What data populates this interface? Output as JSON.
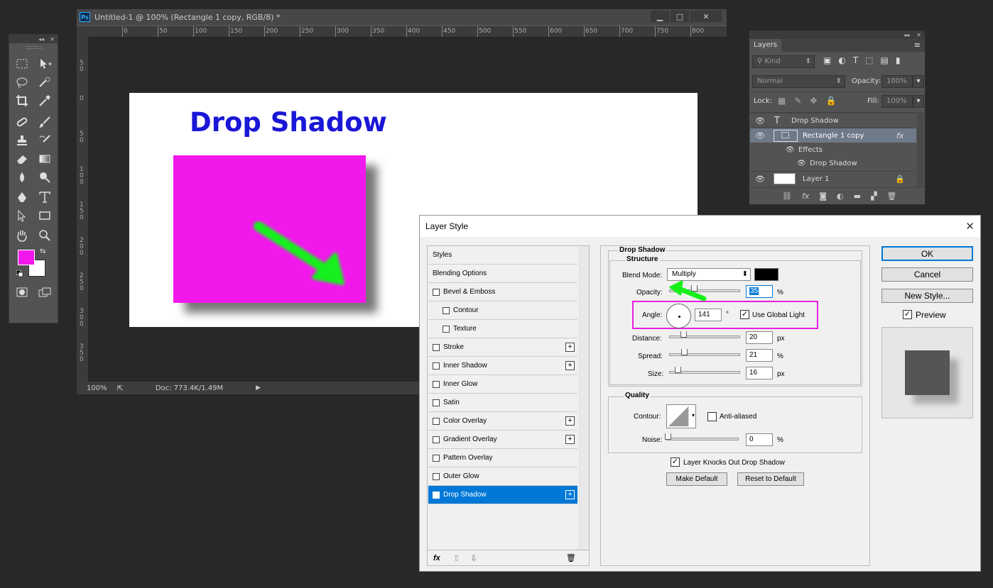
{
  "tools_panel": {
    "collapse": "◂◂",
    "close": "✕"
  },
  "document": {
    "app_badge": "Ps",
    "title": "Untitled-1 @ 100% (Rectangle 1 copy, RGB/8) *",
    "min": "▁",
    "max": "□",
    "close": "✕",
    "ruler_h": [
      "0",
      "50",
      "100",
      "150",
      "200",
      "250",
      "300",
      "350",
      "400",
      "450",
      "500",
      "550",
      "600",
      "650",
      "700",
      "750",
      "800"
    ],
    "ruler_v": [
      "5\n0",
      "0",
      "5\n0",
      "1\n0\n0",
      "1\n5\n0",
      "2\n0\n0",
      "2\n5\n0",
      "3\n0\n0",
      "3\n5\n0"
    ],
    "canvas_heading": "Drop Shadow",
    "zoom": "100%",
    "doc_info": "Doc: 773.4K/1.49M"
  },
  "layers_panel": {
    "tab": "Layers",
    "menu_icon": "≡",
    "collapse": "◂◂",
    "close": "✕",
    "kind": "Kind",
    "blend_mode": "Normal",
    "opacity_label": "Opacity:",
    "opacity_value": "100%",
    "lock_label": "Lock:",
    "fill_label": "Fill:",
    "fill_value": "100%",
    "layers": [
      {
        "name": "Drop Shadow",
        "type": "text"
      },
      {
        "name": "Rectangle 1 copy",
        "type": "shape",
        "fx": "fx"
      },
      {
        "name": "Effects",
        "type": "effects"
      },
      {
        "name": "Drop Shadow",
        "type": "effect"
      },
      {
        "name": "Layer 1",
        "type": "pixel"
      }
    ]
  },
  "dialog": {
    "title": "Layer Style",
    "close": "✕",
    "styles": [
      {
        "label": "Styles",
        "checkbox": false,
        "plus": false,
        "indent": false,
        "checked": false
      },
      {
        "label": "Blending Options",
        "checkbox": false,
        "plus": false,
        "indent": false,
        "checked": false
      },
      {
        "label": "Bevel & Emboss",
        "checkbox": true,
        "plus": false,
        "indent": false,
        "checked": false
      },
      {
        "label": "Contour",
        "checkbox": true,
        "plus": false,
        "indent": true,
        "checked": false
      },
      {
        "label": "Texture",
        "checkbox": true,
        "plus": false,
        "indent": true,
        "checked": false
      },
      {
        "label": "Stroke",
        "checkbox": true,
        "plus": true,
        "indent": false,
        "checked": false
      },
      {
        "label": "Inner Shadow",
        "checkbox": true,
        "plus": true,
        "indent": false,
        "checked": false
      },
      {
        "label": "Inner Glow",
        "checkbox": true,
        "plus": false,
        "indent": false,
        "checked": false
      },
      {
        "label": "Satin",
        "checkbox": true,
        "plus": false,
        "indent": false,
        "checked": false
      },
      {
        "label": "Color Overlay",
        "checkbox": true,
        "plus": true,
        "indent": false,
        "checked": false
      },
      {
        "label": "Gradient Overlay",
        "checkbox": true,
        "plus": true,
        "indent": false,
        "checked": false
      },
      {
        "label": "Pattern Overlay",
        "checkbox": true,
        "plus": false,
        "indent": false,
        "checked": false
      },
      {
        "label": "Outer Glow",
        "checkbox": true,
        "plus": false,
        "indent": false,
        "checked": false
      },
      {
        "label": "Drop Shadow",
        "checkbox": true,
        "plus": true,
        "indent": false,
        "checked": true
      }
    ],
    "footer_icons": {
      "fx": "fx",
      "up": "⇧",
      "down": "⇩",
      "trash": "🗑"
    },
    "section_title": "Drop Shadow",
    "structure": "Structure",
    "blend_mode_label": "Blend Mode:",
    "blend_mode_value": "Multiply",
    "shadow_color": "#000000",
    "opacity_label": "Opacity:",
    "opacity_value": "35",
    "angle_label": "Angle:",
    "angle_value": "141",
    "degree": "°",
    "use_global_light": "Use Global Light",
    "distance_label": "Distance:",
    "distance_value": "20",
    "spread_label": "Spread:",
    "spread_value": "21",
    "size_label": "Size:",
    "size_value": "16",
    "px": "px",
    "pct": "%",
    "quality": "Quality",
    "contour_label": "Contour:",
    "anti_aliased": "Anti-aliased",
    "noise_label": "Noise:",
    "noise_value": "0",
    "knocks_out": "Layer Knocks Out Drop Shadow",
    "make_default": "Make Default",
    "reset_default": "Reset to Default",
    "ok": "OK",
    "cancel": "Cancel",
    "new_style": "New Style...",
    "preview": "Preview",
    "highlight_color": "#e81ee0",
    "accent_color": "#0078d7"
  }
}
